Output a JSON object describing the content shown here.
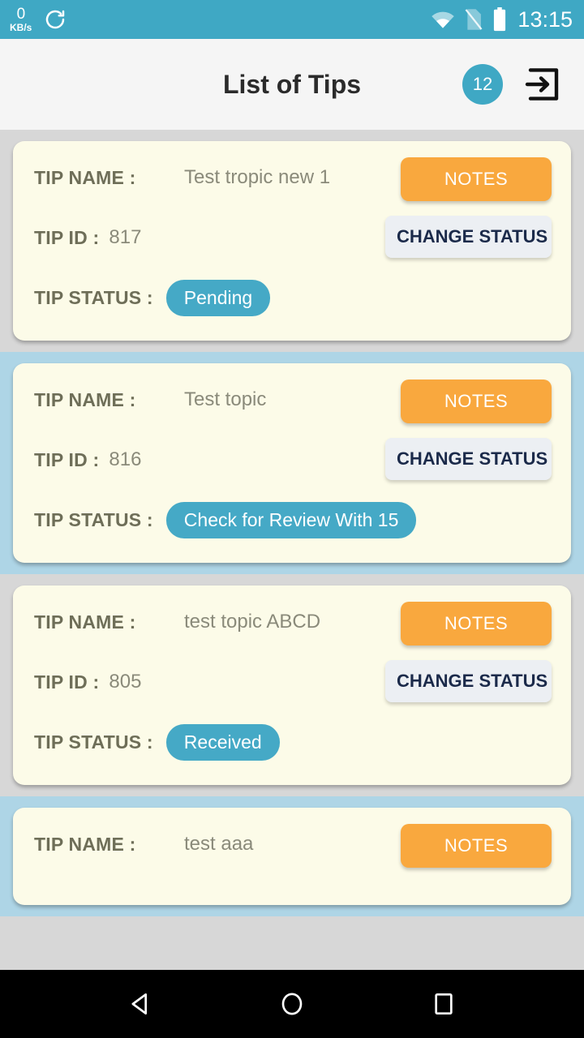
{
  "status_bar": {
    "net_speed_value": "0",
    "net_speed_unit": "KB/s",
    "sync_icon": "sync-refresh-icon",
    "wifi_icon": "wifi-icon",
    "sim_icon": "sim-card-disabled-icon",
    "battery_icon": "battery-full-icon",
    "clock": "13:15",
    "background_color": "#3fa8c4"
  },
  "header": {
    "title": "List of Tips",
    "count_badge": "12",
    "logout_icon": "logout-exit-icon",
    "badge_color": "#3fa8c4",
    "background_color": "#f5f5f5"
  },
  "labels": {
    "tip_name": "TIP NAME :",
    "tip_id": "TIP ID :",
    "tip_status": "TIP STATUS :"
  },
  "buttons": {
    "notes": "NOTES",
    "change_status": "CHANGE STATUS",
    "notes_color": "#f9a83e",
    "change_status_color": "#eceff3"
  },
  "colors": {
    "card_background": "#fcfbe8",
    "row_background_odd": "#d7d7d7",
    "row_background_even": "#aed5e6",
    "status_pill": "#45a9c6",
    "label_text": "#6e6e58",
    "value_text": "#8a8a7a"
  },
  "tips": [
    {
      "name": "Test tropic new 1",
      "id": "817",
      "status": "Pending"
    },
    {
      "name": "Test topic",
      "id": "816",
      "status": "Check for Review With 15"
    },
    {
      "name": "test topic ABCD",
      "id": "805",
      "status": "Received"
    },
    {
      "name": "test aaa",
      "id": "",
      "status": ""
    }
  ],
  "nav_bar": {
    "back_icon": "back-triangle-icon",
    "home_icon": "home-circle-icon",
    "recents_icon": "recents-square-icon"
  }
}
